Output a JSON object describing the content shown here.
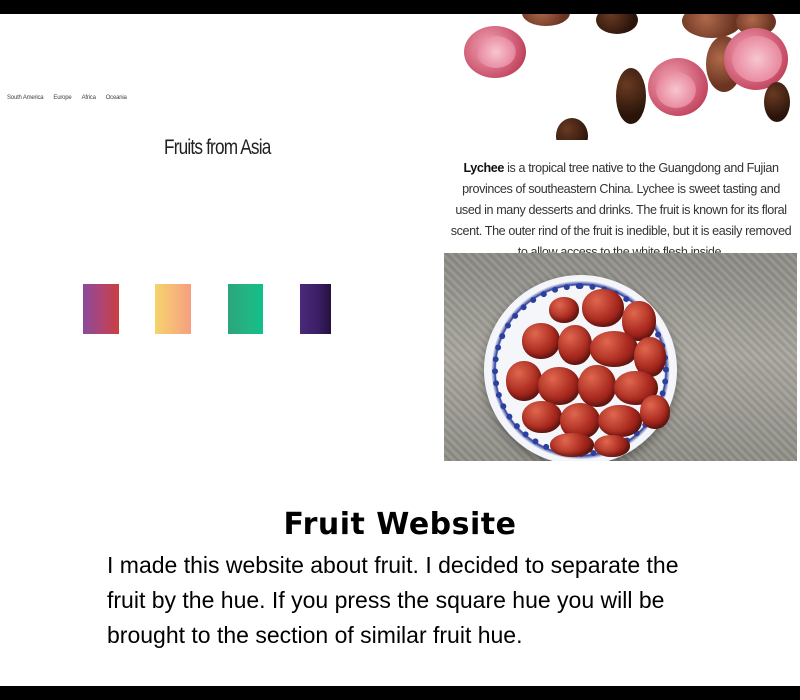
{
  "nav": {
    "items": [
      "South America",
      "Europe",
      "Africa",
      "Oceania"
    ]
  },
  "section": {
    "title": "Fruits from Asia"
  },
  "hue_squares": [
    {
      "name": "purple-red",
      "colors": [
        "#8a4a9c",
        "#c9403e"
      ]
    },
    {
      "name": "yellow-peach",
      "colors": [
        "#f4d46c",
        "#f59e7f"
      ]
    },
    {
      "name": "green",
      "colors": [
        "#2ba57a",
        "#10c08a"
      ]
    },
    {
      "name": "dark-purple",
      "colors": [
        "#4a2a7a",
        "#24113f"
      ]
    }
  ],
  "description": {
    "fruit_name": "Lychee",
    "text": " is a tropical tree native to the Guangdong and Fujian provinces of southeastern China. Lychee is sweet tasting and used in many desserts and drinks. The fruit is known for its floral scent. The outer rind of the fruit is inedible, but it is easily removed to allow access to the white flesh inside."
  },
  "caption": {
    "title": "Fruit Website",
    "body": "I made this website about fruit. I decided to separate the fruit by the hue. If you press the square hue you will be brought to the section of similar fruit hue."
  }
}
